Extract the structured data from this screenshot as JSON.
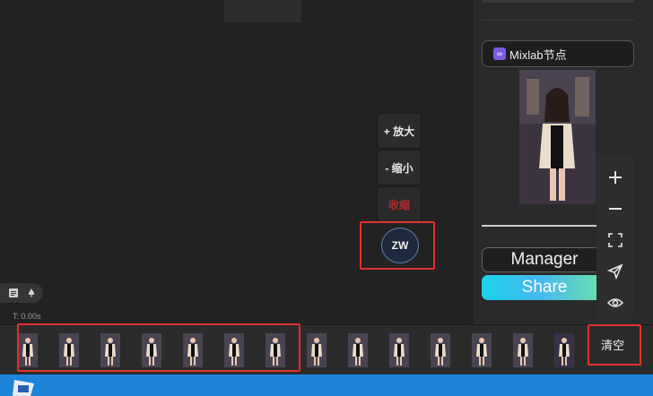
{
  "canvas": {
    "zoom_in_label": "+ 放大",
    "zoom_out_label": "- 缩小",
    "collapse_label": "收缩",
    "zw_label": "ZW",
    "time_label": "T: 0.00s"
  },
  "right_panel": {
    "mixlab_label": "Mixlab节点",
    "manager_label": "Manager",
    "share_label": "Share"
  },
  "float_tools": [
    "plus-icon",
    "minus-icon",
    "fullscreen-icon",
    "send-icon",
    "eye-icon"
  ],
  "mini_tools": [
    "document-icon",
    "pin-icon"
  ],
  "timeline": {
    "frame_count": 14,
    "clear_label": "清空"
  },
  "colors": {
    "accent_red": "#e0312b",
    "share_gradient_start": "#1cd3ea",
    "share_gradient_end": "#6ee2a8",
    "collapse_text": "#b22a2a",
    "taskbar": "#1e84d8"
  }
}
